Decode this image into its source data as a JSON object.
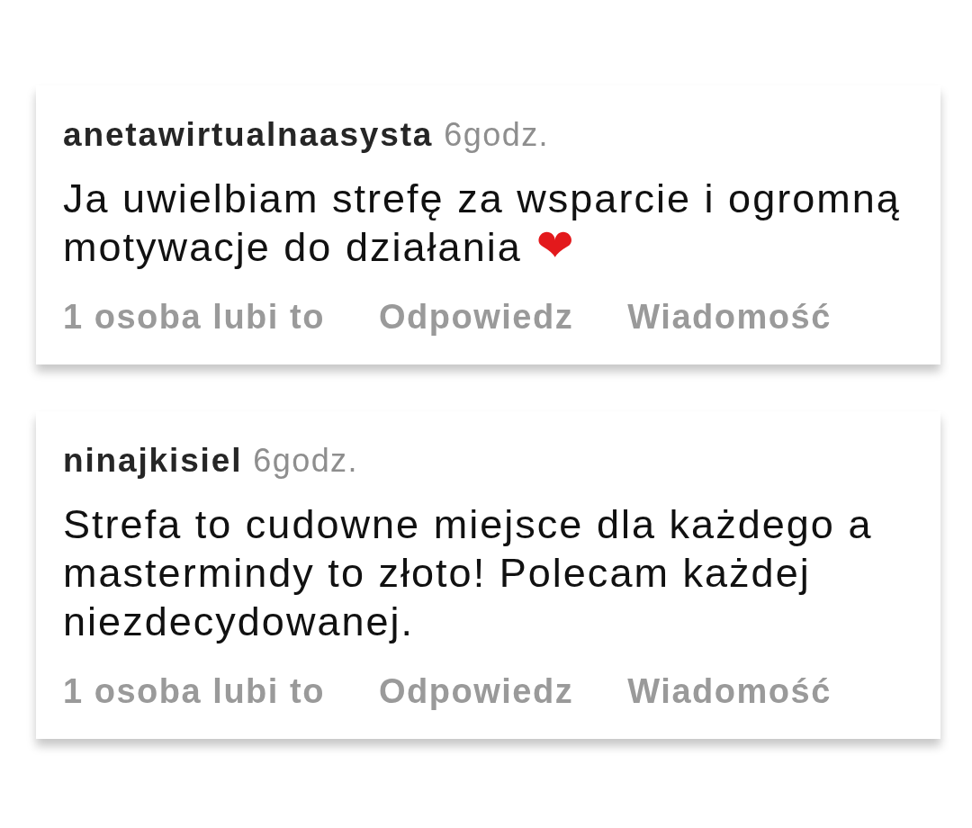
{
  "comments": [
    {
      "username": "anetawirtualnaasysta",
      "time": "6godz.",
      "text": "Ja uwielbiam strefę za wsparcie i ogromną motywacje do działania",
      "emoji": "❤",
      "likes": "1 osoba lubi to",
      "actions": [
        "Odpowiedz",
        "Wiadomość"
      ]
    },
    {
      "username": "ninajkisiel",
      "time": "6godz.",
      "text": "Strefa to cudowne miejsce dla każdego a mastermindy to złoto! Polecam każdej niezdecydowanej.",
      "likes": "1 osoba lubi to",
      "actions": [
        "Odpowiedz",
        "Wiadomość"
      ]
    }
  ]
}
